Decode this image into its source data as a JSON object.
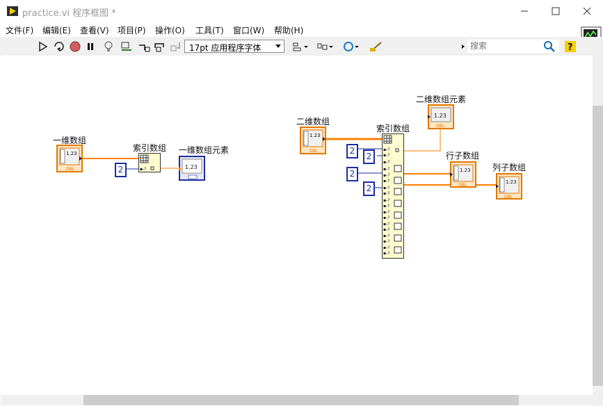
{
  "window": {
    "title": "practice.vi 程序框图 *",
    "app_icon": "labview-run-arrow-icon",
    "controls": [
      "minimize-icon",
      "maximize-icon",
      "close-icon"
    ]
  },
  "menu": [
    "文件(F)",
    "编辑(E)",
    "查看(V)",
    "项目(P)",
    "操作(O)",
    "工具(T)",
    "窗口(W)",
    "帮助(H)"
  ],
  "toolbar": {
    "buttons": [
      "run-icon",
      "run-continuously-icon",
      "abort-icon",
      "pause-icon",
      "highlight-execution-icon",
      "retain-wire-values-icon",
      "step-into-icon",
      "step-over-icon",
      "step-out-icon",
      "align-objects-icon",
      "distribute-objects-icon",
      "reorder-icon",
      "clean-up-diagram-icon"
    ],
    "font": "17pt 应用程序字体",
    "search_placeholder": "搜索",
    "search_icon": "magnifier-icon",
    "help_icon": "context-help-icon"
  },
  "diagram": {
    "group1": {
      "array_label": "一维数组",
      "index_label": "索引数组",
      "index_const": "2",
      "result_label": "一维数组元素",
      "array_terminal_text": "1.23",
      "array_type": "DBL",
      "result_terminal_text": "1.23"
    },
    "group2": {
      "array_label": "二维数组",
      "index_label": "索引数组",
      "element_label": "二维数组元素",
      "row_label": "行子数组",
      "col_label": "列子数组",
      "const_a": "2",
      "const_b": "2",
      "const_c": "2",
      "const_d": "2",
      "terminal_text": "1.23",
      "terminal_type": "DBL"
    }
  },
  "colors": {
    "wire_dbl": "#ff7f00",
    "wire_int": "#1c2da0",
    "node_fill": "#fffbd0",
    "terminal_border": "#e07800"
  }
}
